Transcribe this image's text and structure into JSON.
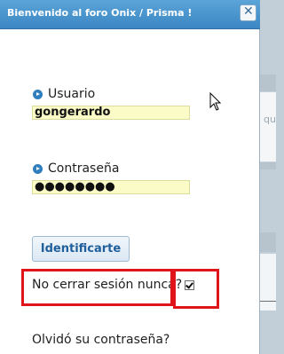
{
  "dialog": {
    "title": "Bienvenido al foro Onix / Prisma !",
    "close_label": "x"
  },
  "login": {
    "username_label": "Usuario",
    "username_value": "gongerardo",
    "password_label": "Contraseña",
    "password_value": "●●●●●●●●",
    "submit_label": "Identificarte",
    "remember_label": "No cerrar sesión nunca?",
    "remember_checked": true,
    "forgot_label": "Olvidó su contraseña?"
  },
  "background": {
    "partial_text": "qu"
  },
  "colors": {
    "titlebar": "#4a96d0",
    "input_fill": "#fbfbc8",
    "highlight_box": "#e0151c",
    "button_text": "#1f5f9b"
  },
  "icons": {
    "bullet": "arrow-circle-icon",
    "close": "close-icon",
    "cursor": "mouse-pointer-icon"
  }
}
